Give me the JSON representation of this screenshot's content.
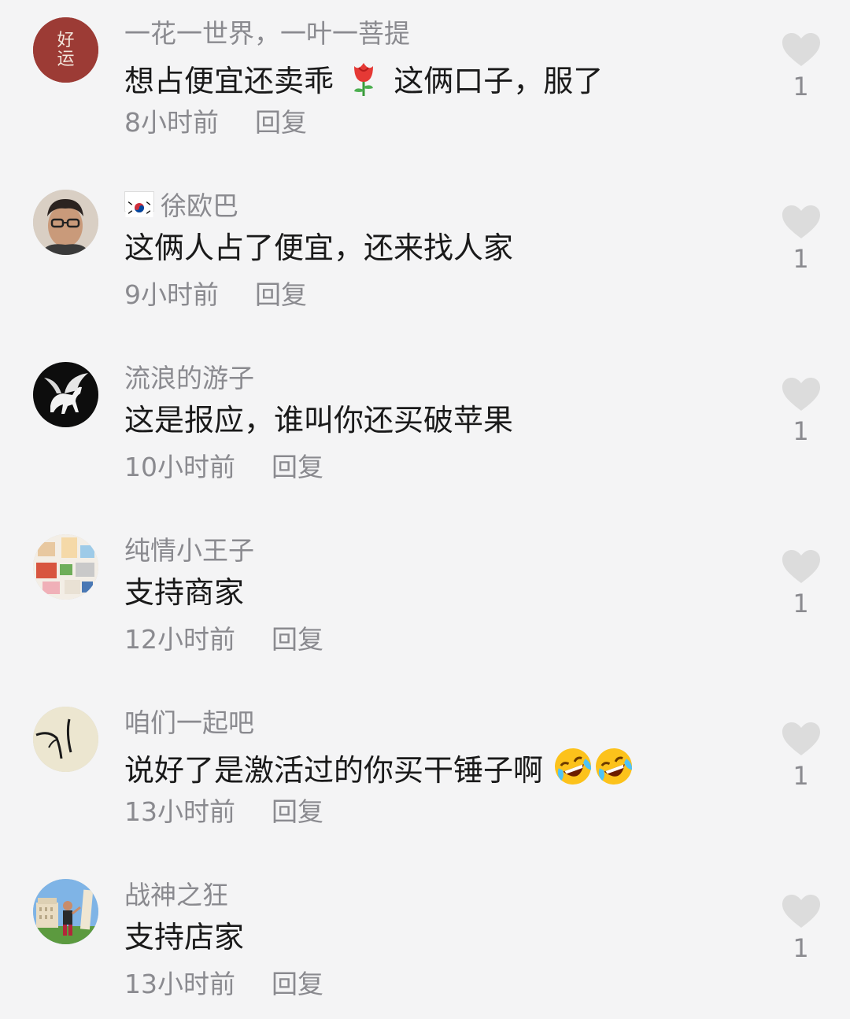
{
  "comments": [
    {
      "username": "一花一世界，一叶一菩提",
      "text_before": "想占便宜还卖乖",
      "text_after": " 这俩口子，服了",
      "time": "8小时前",
      "reply": "回复",
      "likes": "1",
      "avatar_text": "好运"
    },
    {
      "username": "徐欧巴",
      "text": "这俩人占了便宜，还来找人家",
      "time": "9小时前",
      "reply": "回复",
      "likes": "1"
    },
    {
      "username": "流浪的游子",
      "text": "这是报应，谁叫你还买破苹果",
      "time": "10小时前",
      "reply": "回复",
      "likes": "1"
    },
    {
      "username": "纯情小王子",
      "text": "支持商家",
      "time": "12小时前",
      "reply": "回复",
      "likes": "1"
    },
    {
      "username": "咱们一起吧",
      "text": "说好了是激活过的你买干锤子啊",
      "time": "13小时前",
      "reply": "回复",
      "likes": "1"
    },
    {
      "username": "战神之狂",
      "text": "支持店家",
      "time": "13小时前",
      "reply": "回复",
      "likes": "1"
    }
  ],
  "icons": {
    "like": "heart-icon",
    "rose": "rose-emoji",
    "laugh": "rofl-emoji",
    "flag": "korea-flag-icon"
  },
  "colors": {
    "background": "#f4f4f5",
    "secondary_text": "#8a8a8f",
    "heart": "#dcdcdc"
  }
}
